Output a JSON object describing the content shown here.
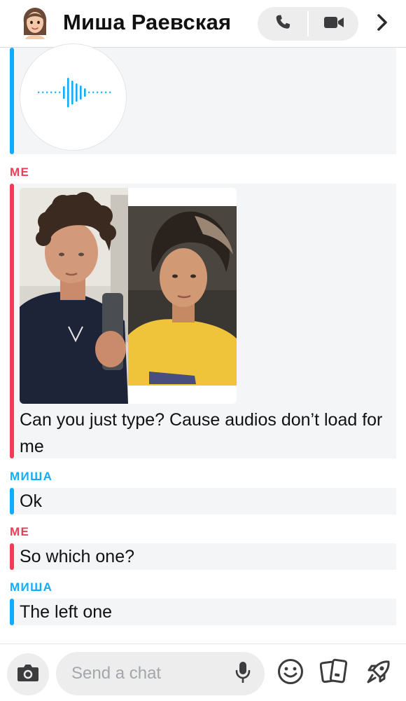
{
  "header": {
    "contact_name": "Миша Раевская",
    "avatar_icon": "bitmoji-avatar",
    "call_icon": "phone-icon",
    "video_icon": "video-camera-icon",
    "more_icon": "chevron-right-icon"
  },
  "colors": {
    "me_accent": "#f23c57",
    "them_accent": "#0fadff",
    "bubble_bg": "#f4f5f7"
  },
  "messages": [
    {
      "sender": "",
      "type": "audio",
      "icon": "audio-waveform-icon"
    },
    {
      "sender": "ME",
      "type": "photo",
      "icon": "photo-collage"
    },
    {
      "sender": "",
      "text": "Can you just type? Cause audios don’t load for me"
    },
    {
      "sender": "МИША",
      "text": "Ok"
    },
    {
      "sender": "ME",
      "text": "So which one?"
    },
    {
      "sender": "МИША",
      "text": "The left one"
    }
  ],
  "input": {
    "placeholder": "Send a chat",
    "camera_icon": "camera-icon",
    "mic_icon": "microphone-icon",
    "emoji_icon": "smiley-icon",
    "stickers_icon": "cards-icon",
    "games_icon": "rocket-icon"
  }
}
